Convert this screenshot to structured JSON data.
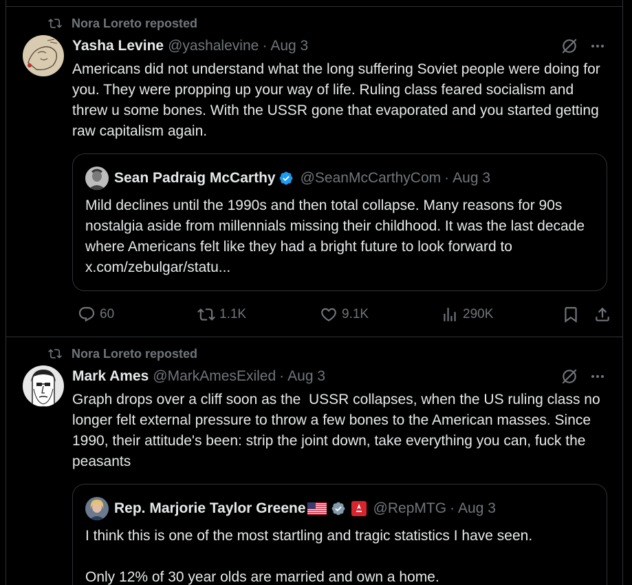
{
  "tweets": [
    {
      "repost_label": "Nora Loreto reposted",
      "author": {
        "name": "Yasha Levine",
        "handle": "@yashalevine",
        "date": "Aug 3"
      },
      "text": "Americans did not understand what the long suffering Soviet people were doing for you. They were propping up your way of life. Ruling class feared socialism and threw u some bones. With the USSR gone that evaporated and you started getting raw capitalism again.",
      "quote": {
        "name": "Sean Padraig McCarthy",
        "verified": true,
        "handle": "@SeanMcCarthyCom",
        "date": "Aug 3",
        "text": "Mild declines until the 1990s and then total collapse. Many reasons for 90s nostalgia aside from millennials missing their childhood. It was the last decade where Americans felt like they had a bright future to look forward to x.com/zebulgar/statu..."
      },
      "stats": {
        "replies": "60",
        "reposts": "1.1K",
        "likes": "9.1K",
        "views": "290K"
      }
    },
    {
      "repost_label": "Nora Loreto reposted",
      "author": {
        "name": "Mark Ames",
        "handle": "@MarkAmesExiled",
        "date": "Aug 3"
      },
      "text": "Graph drops over a cliff soon as the  USSR collapses, when the US ruling class no longer felt external pressure to throw a few bones to the American masses. Since 1990, their attitude's been: strip the joint down, take everything you can, fuck the peasants",
      "quote": {
        "name": "Rep. Marjorie Taylor Greene",
        "flag": "🇺🇸",
        "verified": true,
        "handle": "@RepMTG",
        "date": "Aug 3",
        "text": "I think this is one of the most startling and tragic statistics I have seen.\n\nOnly 12% of 30 year olds are married and own a home."
      }
    }
  ],
  "colors": {
    "background": "#000000",
    "text": "#e7e9ea",
    "muted": "#71767b",
    "border": "#2f3336",
    "verified": "#1d9bf0"
  },
  "icons": [
    "repost-icon",
    "grok-icon",
    "more-icon",
    "reply-icon",
    "like-icon",
    "views-icon",
    "bookmark-icon",
    "share-icon",
    "verified-badge-icon"
  ]
}
